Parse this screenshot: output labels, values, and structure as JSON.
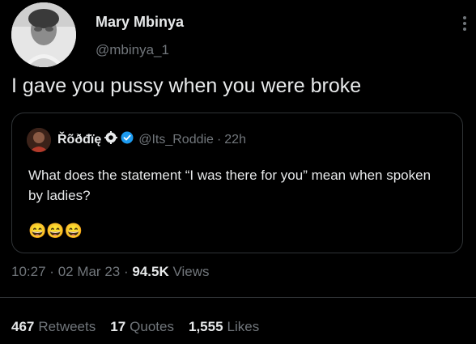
{
  "author": {
    "name": "Mary Mbinya",
    "handle": "@mbinya_1"
  },
  "tweet": {
    "text": "I gave you pussy when you were broke"
  },
  "quoted_tweet": {
    "author_name": "Řõðđïę",
    "handle": "@Its_Roddie",
    "separator": "·",
    "time": "22h",
    "text": "What does the statement “I was there for you” mean when spoken by ladies?",
    "emojis": "😄😄😄",
    "badge_icons": [
      "gear-icon",
      "verified-badge-icon"
    ]
  },
  "meta": {
    "time": "10:27",
    "separator1": "·",
    "date": "02 Mar 23",
    "separator2": "·",
    "views_count": "94.5K",
    "views_label": "Views"
  },
  "stats": {
    "retweets_count": "467",
    "retweets_label": "Retweets",
    "quotes_count": "17",
    "quotes_label": "Quotes",
    "likes_count": "1,555",
    "likes_label": "Likes"
  },
  "colors": {
    "background": "#000000",
    "primary_text": "#e7e9ea",
    "secondary_text": "#71767b",
    "border": "#2f3336",
    "verified": "#1d9bf0"
  }
}
